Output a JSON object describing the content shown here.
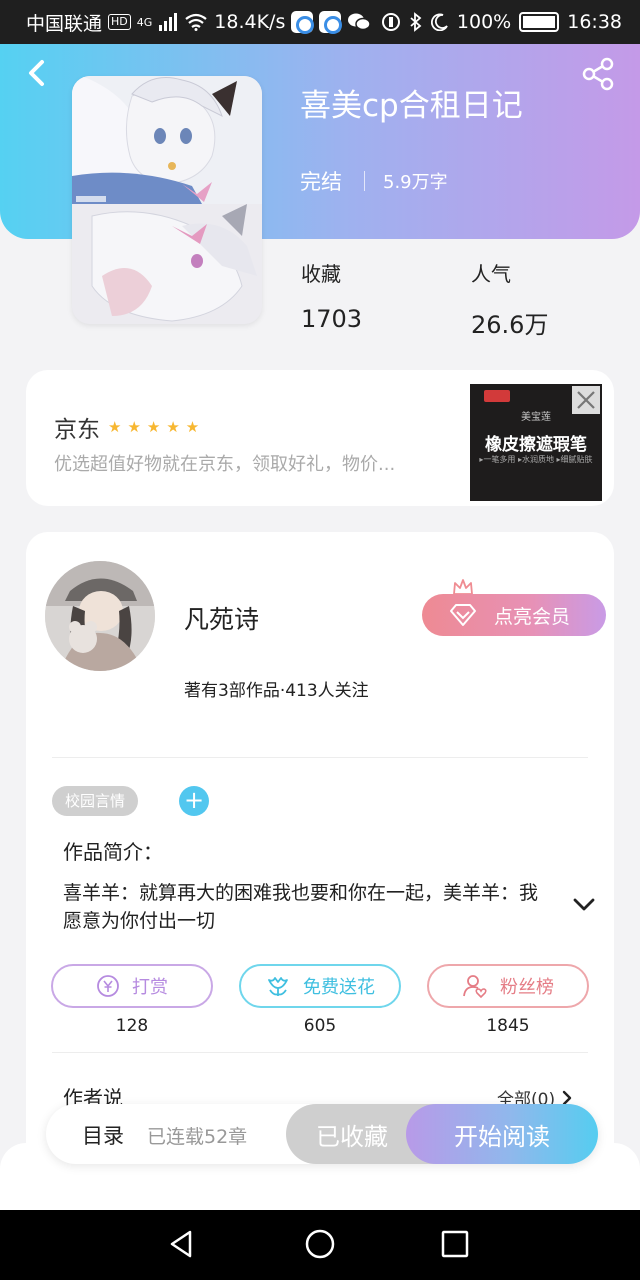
{
  "status_bar": {
    "carrier": "中国联通",
    "hd": "HD",
    "network": "4G",
    "speed": "18.4K/s",
    "battery": "100%",
    "time": "16:38"
  },
  "book": {
    "title": "喜美cp合租日记",
    "status": "完结",
    "word_count": "5.9万字",
    "favorites_label": "收藏",
    "favorites_value": "1703",
    "popularity_label": "人气",
    "popularity_value": "26.6万"
  },
  "ad": {
    "brand": "京东",
    "stars": "★★★★★",
    "description": "优选超值好物就在京东，领取好礼，物价...",
    "image_sub": "美宝莲",
    "image_title": "橡皮擦遮瑕笔",
    "image_tags": "▸一笔多用 ▸水润质地 ▸细腻贴肤"
  },
  "author": {
    "name": "凡苑诗",
    "info": "著有3部作品·413人关注",
    "vip_label": "点亮会员"
  },
  "tags": [
    "校园言情"
  ],
  "intro": {
    "label": "作品简介：",
    "text": "喜羊羊：就算再大的困难我也要和你在一起，美羊羊：我愿意为你付出一切"
  },
  "actions": [
    {
      "label": "打赏",
      "count": "128",
      "icon": "yuan-icon",
      "color": "#b68be0"
    },
    {
      "label": "免费送花",
      "count": "605",
      "icon": "flower-icon",
      "color": "#3fbfe0"
    },
    {
      "label": "粉丝榜",
      "count": "1845",
      "icon": "fan-icon",
      "color": "#e57d86"
    }
  ],
  "author_says": {
    "label": "作者说",
    "all_link": "全部(0)"
  },
  "bottom_bar": {
    "toc": "目录",
    "chapters": "已连载52章",
    "collected": "已收藏",
    "read": "开始阅读"
  },
  "colors": {
    "header_gradient_start": "#55d1f2",
    "header_gradient_end": "#c49ae8",
    "vip_gradient_start": "#ee8a93",
    "vip_gradient_end": "#c99be6",
    "tag_add": "#52c7ef"
  }
}
